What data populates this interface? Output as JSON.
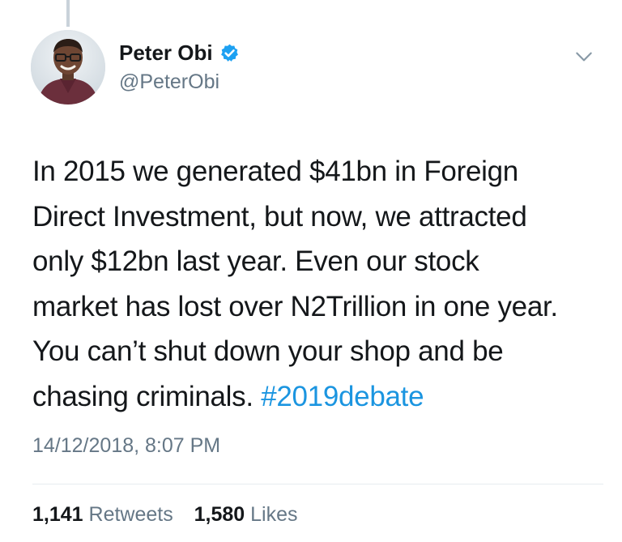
{
  "author": {
    "display_name": "Peter Obi",
    "handle": "@PeterObi",
    "verified": true,
    "avatar_icon": "profile-photo",
    "verified_icon": "verified-badge-icon"
  },
  "menu": {
    "icon": "chevron-down-icon"
  },
  "tweet": {
    "text_main": "In 2015 we generated $41bn in Foreign\nDirect Investment, but now, we attracted\nonly $12bn last year. Even our stock\nmarket has lost over N2Trillion in one year.\nYou can’t shut down your shop and be\nchasing criminals. ",
    "hashtag": "#2019debate",
    "timestamp": "14/12/2018, 8:07 PM"
  },
  "stats": {
    "retweets_count": "1,141",
    "retweets_label": "Retweets",
    "likes_count": "1,580",
    "likes_label": "Likes"
  },
  "colors": {
    "text": "#14171a",
    "secondary": "#657786",
    "accent": "#1b95e0",
    "verified": "#1da1f2"
  }
}
